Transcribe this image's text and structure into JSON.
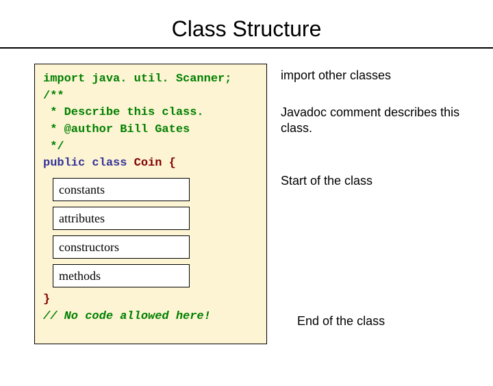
{
  "title": "Class Structure",
  "code": {
    "line1": "import java. util. Scanner;",
    "line2": "/**",
    "line3": " * Describe this class.",
    "line4": " * @author Bill Gates",
    "line5": " */",
    "line6_a": "public class",
    "line6_b": " Coin {",
    "box_constants": "constants",
    "box_attributes": "attributes",
    "box_constructors": "constructors",
    "box_methods": "methods",
    "line_close": "}",
    "line_end": "// No code allowed here!"
  },
  "annotations": {
    "a1": "import other classes",
    "a2": "Javadoc comment describes this class.",
    "a3": " Start of the class",
    "a4": "End of the class"
  }
}
